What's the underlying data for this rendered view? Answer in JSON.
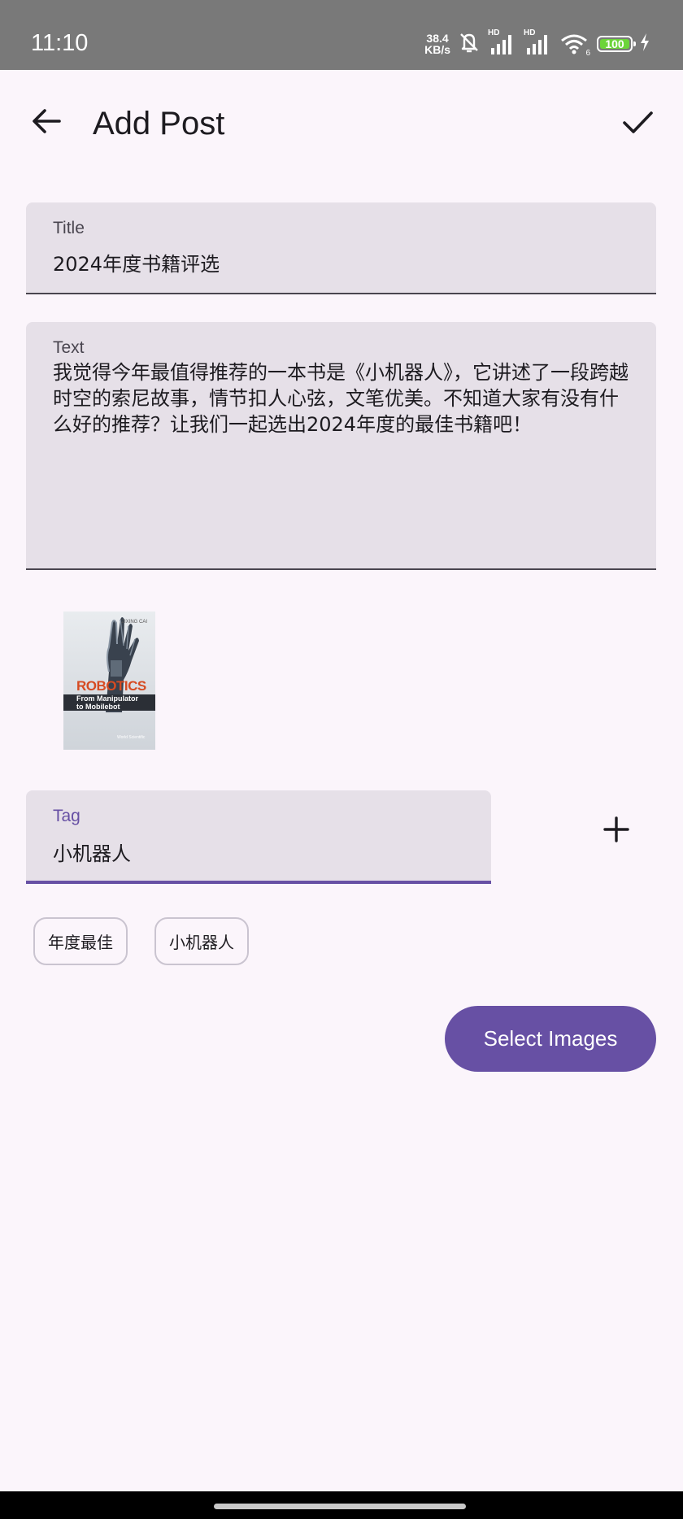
{
  "status_bar": {
    "time": "11:10",
    "net_speed_value": "38.4",
    "net_speed_unit": "KB/s",
    "signal_1_label": "HD",
    "signal_2_label": "HD",
    "wifi_label": "6",
    "battery_level": "100",
    "icons": [
      "mute-bell-icon",
      "signal-icon",
      "signal-icon",
      "wifi-icon",
      "battery-icon",
      "charging-icon"
    ]
  },
  "app_bar": {
    "title": "Add Post",
    "back_icon": "arrow-back-icon",
    "confirm_icon": "check-icon"
  },
  "form": {
    "title_field": {
      "label": "Title",
      "value": "2024年度书籍评选"
    },
    "text_field": {
      "label": "Text",
      "value": "我觉得今年最值得推荐的一本书是《小机器人》，它讲述了一段跨越时空的索尼故事，情节扣人心弦，文笔优美。不知道大家有没有什么好的推荐？让我们一起选出2024年度的最佳书籍吧！"
    },
    "tag_field": {
      "label": "Tag",
      "value": "小机器人"
    },
    "add_tag_icon": "plus-icon"
  },
  "image_thumbnail": {
    "cover_title": "ROBOTICS",
    "cover_subtitle_1": "From Manipulator",
    "cover_subtitle_2": "to Mobilebot",
    "cover_author": "ZIXING CAI",
    "cover_publisher": "World Scientific"
  },
  "tags": [
    {
      "label": "年度最佳"
    },
    {
      "label": "小机器人"
    }
  ],
  "select_images_button": {
    "label": "Select Images"
  },
  "colors": {
    "background": "#fbf5fb",
    "field_bg": "#e6e0e8",
    "primary": "#6750a4",
    "status_bar": "#797979",
    "battery_fill": "#6cd43a"
  }
}
